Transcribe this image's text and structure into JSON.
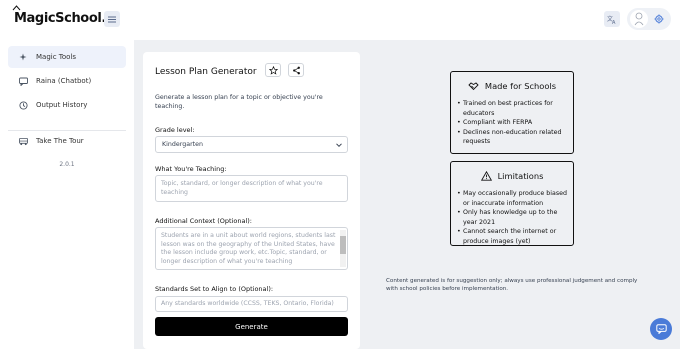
{
  "brand": {
    "logo": "MagicSchool.ai"
  },
  "sidebar": {
    "items": [
      {
        "label": "Magic Tools",
        "icon": "sparkles-icon",
        "active": true
      },
      {
        "label": "Raina (Chatbot)",
        "icon": "chat-icon",
        "active": false
      },
      {
        "label": "Output History",
        "icon": "history-icon",
        "active": false
      }
    ],
    "tour_label": "Take The Tour",
    "version": "2.0.1"
  },
  "form": {
    "title": "Lesson Plan Generator",
    "description": "Generate a lesson plan for a topic or objective you're teaching.",
    "grade": {
      "label": "Grade level:",
      "value": "Kindergarten"
    },
    "teaching": {
      "label": "What You're Teaching:",
      "placeholder": "Topic, standard, or longer description of what you're teaching"
    },
    "context": {
      "label": "Additional Context (Optional):",
      "placeholder": "Students are in a unit about world regions, students last lesson was on the geography of the United States, have the lesson include group work, etc.Topic, standard, or longer description of what you're teaching"
    },
    "standards": {
      "label": "Standards Set to Align to (Optional):",
      "placeholder": "Any standards worldwide (CCSS, TEKS, Ontario, Florida)"
    },
    "generate_label": "Generate"
  },
  "info": {
    "schools": {
      "title": "Made for Schools",
      "items": [
        "Trained on best practices for educators",
        "Compliant with FERPA",
        "Declines non-education related requests"
      ]
    },
    "limitations": {
      "title": "Limitations",
      "items": [
        "May occasionally produce biased or inaccurate information",
        "Only has knowledge up to the year 2021",
        "Cannot search the internet or produce images (yet)"
      ]
    }
  },
  "disclaimer": "Content generated is for suggestion only; always use professional judgement and comply with school policies before implementation.",
  "colors": {
    "accent": "#4a7bd8",
    "main_bg": "#eef0f3",
    "active_nav": "#eef2fb"
  }
}
